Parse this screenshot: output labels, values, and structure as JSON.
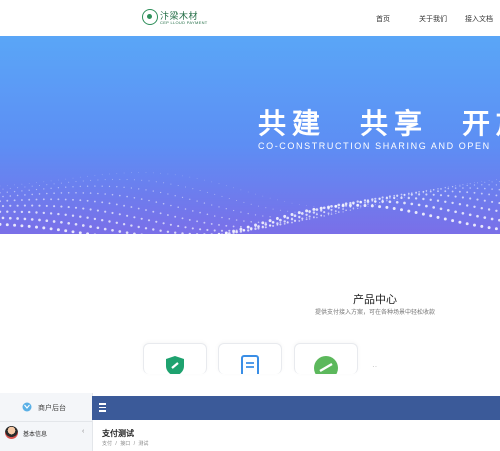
{
  "header": {
    "logo": {
      "title": "汴梁木材",
      "subtitle": "CEP LLOUD PAYMENT"
    },
    "nav": [
      {
        "label": "首页"
      },
      {
        "label": "关于我们"
      },
      {
        "label": "接入文档"
      }
    ]
  },
  "hero": {
    "title": "共建　共享　开放",
    "subtitle": "CO-CONSTRUCTION SHARING AND OPEN"
  },
  "products": {
    "title": "产品中心",
    "description": "提供支付接入方案，可在各种场景中轻松收款",
    "cards": [
      {
        "icon": "shield-icon",
        "color": "#1ea26f"
      },
      {
        "icon": "document-icon",
        "color": "#3a8ee6"
      },
      {
        "icon": "check-circle-icon",
        "color": "#5cb85c"
      }
    ],
    "more": "··"
  },
  "admin": {
    "brand": "商户后台",
    "menu_item": "基本信息",
    "menu_chevron": "‹",
    "page_title": "支付测试",
    "breadcrumb": [
      "支付",
      "接口",
      "测试"
    ],
    "breadcrumb_sep": "/",
    "header_color": "#3b5a99"
  }
}
